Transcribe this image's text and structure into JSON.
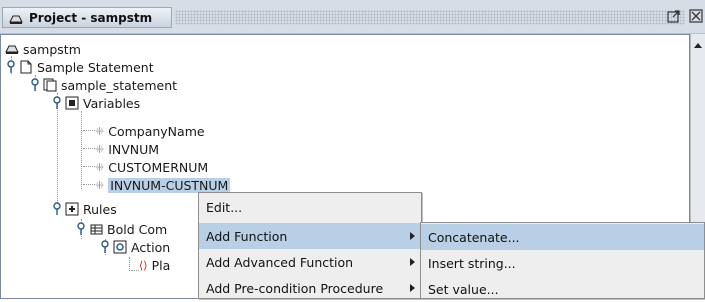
{
  "window": {
    "title": "Project - sampstm"
  },
  "tree": {
    "root": "sampstm",
    "statement": "Sample Statement",
    "doc": "sample_statement",
    "variables_label": "Variables",
    "variables": [
      "CompanyName",
      "INVNUM",
      "CUSTOMERNUM",
      "INVNUM-CUSTNUM"
    ],
    "rules_label": "Rules",
    "rule_partial": "Bold Com",
    "action_partial": "Action",
    "placeholder_partial": "Pla"
  },
  "context_menu": {
    "items": [
      "Edit...",
      "Add Function",
      "Add Advanced Function",
      "Add Pre-condition Procedure"
    ]
  },
  "submenu": {
    "items": [
      "Concatenate...",
      "Insert string...",
      "Set value..."
    ]
  },
  "colors": {
    "selection": "#b8cfe5",
    "menu_bg": "#eeeeee",
    "titlebar": "#d6dde6"
  }
}
